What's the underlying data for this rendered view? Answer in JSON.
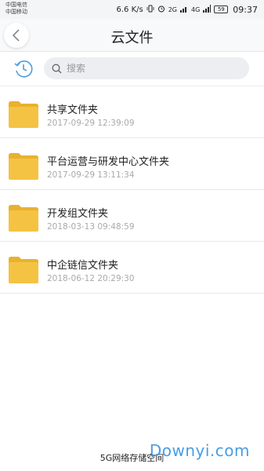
{
  "status_bar": {
    "carrier_1": "中国电信",
    "carrier_2": "中国移动",
    "speed": "6.6 K/s",
    "net_1": "2G",
    "net_2": "4G",
    "battery": "59",
    "time": "09:37"
  },
  "header": {
    "title": "云文件"
  },
  "search": {
    "placeholder": "搜索"
  },
  "files": [
    {
      "name": "共享文件夹",
      "date": "2017-09-29 12:39:09"
    },
    {
      "name": "平台运营与研发中心文件夹",
      "date": "2017-09-29 13:11:34"
    },
    {
      "name": "开发组文件夹",
      "date": "2018-03-13 09:48:59"
    },
    {
      "name": "中企链信文件夹",
      "date": "2018-06-12 20:29:30"
    }
  ],
  "footer": {
    "text": "5G网络存储空间"
  },
  "watermark": "Downyi.com",
  "colors": {
    "folder": "#f5c343",
    "folder_tab": "#e9b12f",
    "accent": "#4a9fe0"
  }
}
